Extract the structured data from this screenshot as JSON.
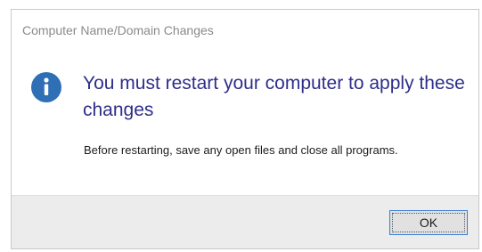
{
  "dialog": {
    "title": "Computer Name/Domain Changes",
    "icon": "info-icon",
    "main_instruction": "You must restart your computer to apply these changes",
    "body": "Before restarting, save any open files and close all programs.",
    "ok_label": "OK"
  },
  "colors": {
    "title_text": "#8a8a8a",
    "main_instruction": "#2e2e8a",
    "icon_fill": "#2f6fb6",
    "footer_bg": "#ececec",
    "button_border": "#3c7fd6"
  }
}
